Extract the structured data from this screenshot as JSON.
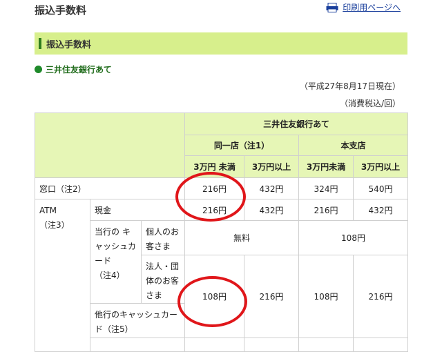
{
  "header": {
    "title": "振込手数料",
    "print_link": "印刷用ページへ"
  },
  "section": {
    "title": "振込手数料"
  },
  "bank_heading": "三井住友銀行あて",
  "notes": {
    "date": "（平成27年8月17日現在）",
    "tax": "（消費税込/回）"
  },
  "table": {
    "group_header": "三井住友銀行あて",
    "same_branch": "同一店（注1）",
    "main_branch": "本支店",
    "col_under": "3万円 未満",
    "col_over": "3万円以上",
    "col_under2": "3万円未満",
    "col_over2": "3万円以上",
    "window": {
      "label": "窓口",
      "note": "（注2）",
      "values": [
        "216円",
        "432円",
        "324円",
        "540円"
      ]
    },
    "atm": {
      "label": "ATM",
      "note": "（注3）",
      "cash": {
        "label": "現金",
        "values": [
          "216円",
          "432円",
          "216円",
          "432円"
        ]
      },
      "own_card": {
        "label": "当行の キャッシュカード",
        "note": "（注4）",
        "individual": {
          "label": "個人のお客さま",
          "same": "無料",
          "main": "108円"
        },
        "corporate": {
          "label": "法人・団体のお客さま"
        }
      },
      "other_card": {
        "label": "他行のキャッシュカード",
        "note": "（注5）"
      },
      "card_values": [
        "108円",
        "216円",
        "108円",
        "216円"
      ]
    }
  }
}
